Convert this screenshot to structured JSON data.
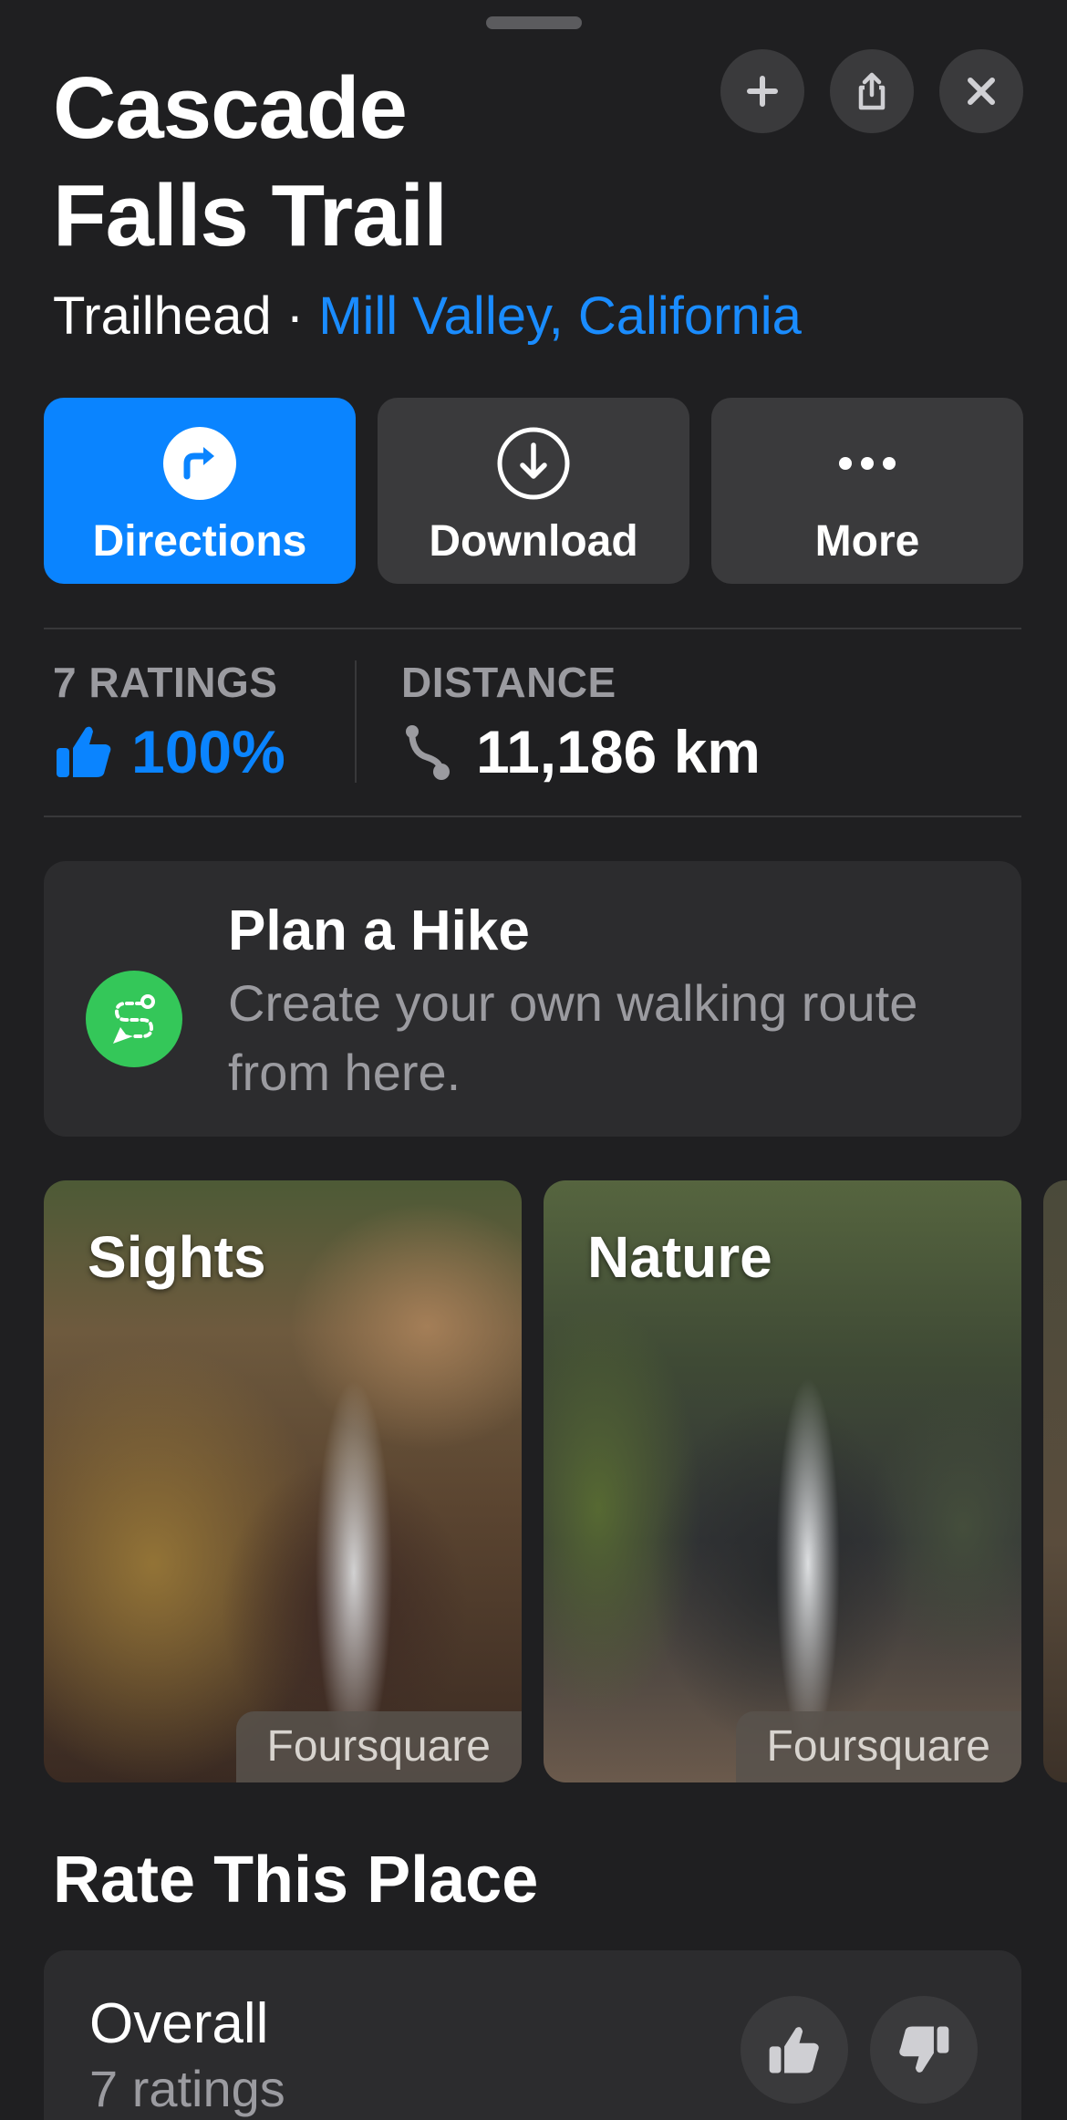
{
  "header": {
    "title_line1": "Cascade",
    "title_line2": "Falls Trail",
    "category": "Trailhead",
    "separator": " · ",
    "location": "Mill Valley, California"
  },
  "top_buttons": [
    "add-icon",
    "share-icon",
    "close-icon"
  ],
  "actions": [
    {
      "label": "Directions",
      "icon": "directions-icon"
    },
    {
      "label": "Download",
      "icon": "download-icon"
    },
    {
      "label": "More",
      "icon": "more-icon"
    }
  ],
  "stats": {
    "ratings_label": "7 RATINGS",
    "ratings_value": "100%",
    "distance_label": "DISTANCE",
    "distance_value": "11,186 km"
  },
  "plan_hike": {
    "title": "Plan a Hike",
    "description": "Create your own walking route from here."
  },
  "photos": [
    {
      "title": "Sights",
      "credit": "Foursquare"
    },
    {
      "title": "Nature",
      "credit": "Foursquare"
    }
  ],
  "rate": {
    "section_title": "Rate This Place",
    "label": "Overall",
    "count": "7 ratings"
  },
  "colors": {
    "accent": "#0a84ff",
    "link": "#1a8cff",
    "hike_green": "#34c759",
    "background": "#1f1f21",
    "card": "#2c2c2e"
  }
}
